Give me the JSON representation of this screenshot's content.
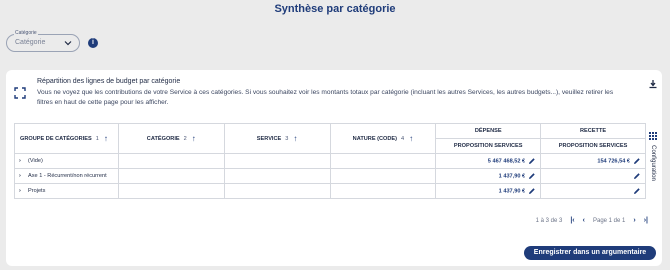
{
  "page": {
    "title": "Synthèse par catégorie"
  },
  "filter": {
    "legend": "Catégorie",
    "placeholder": "Catégorie"
  },
  "card": {
    "heading": "Répartition des lignes de budget par catégorie",
    "description": "Vous ne voyez que les contributions de votre Service à ces catégories. Si vous souhaitez voir les montants totaux par catégorie (incluant les autres Services, les autres budgets...), veuillez retirer les filtres en haut de cette page pour les afficher.",
    "config_label": "Configuration"
  },
  "table": {
    "headers": {
      "group": "GROUPE DE CATÉGORIES",
      "group_num": "1",
      "category": "CATÉGORIE",
      "category_num": "2",
      "service": "SERVICE",
      "service_num": "3",
      "nature": "NATURE (CODE)",
      "nature_num": "4",
      "expense": "DÉPENSE",
      "revenue": "RECETTE",
      "expense_sub": "PROPOSITION SERVICES",
      "revenue_sub": "PROPOSITION SERVICES"
    },
    "rows": [
      {
        "label": "(Vide)",
        "expense": "5 467 468,52 €",
        "revenue": "154 726,54 €"
      },
      {
        "label": "Axe 1 - Récurrent/non récurrent",
        "expense": "1 437,90 €",
        "revenue": ""
      },
      {
        "label": "Projets",
        "expense": "1 437,90 €",
        "revenue": ""
      }
    ]
  },
  "pager": {
    "range": "1 à 3 de 3",
    "page": "Page 1 de 1"
  },
  "actions": {
    "save": "Enregistrer dans un argumentaire"
  },
  "colors": {
    "primary": "#1f3c7a",
    "background": "#ebebeb"
  }
}
